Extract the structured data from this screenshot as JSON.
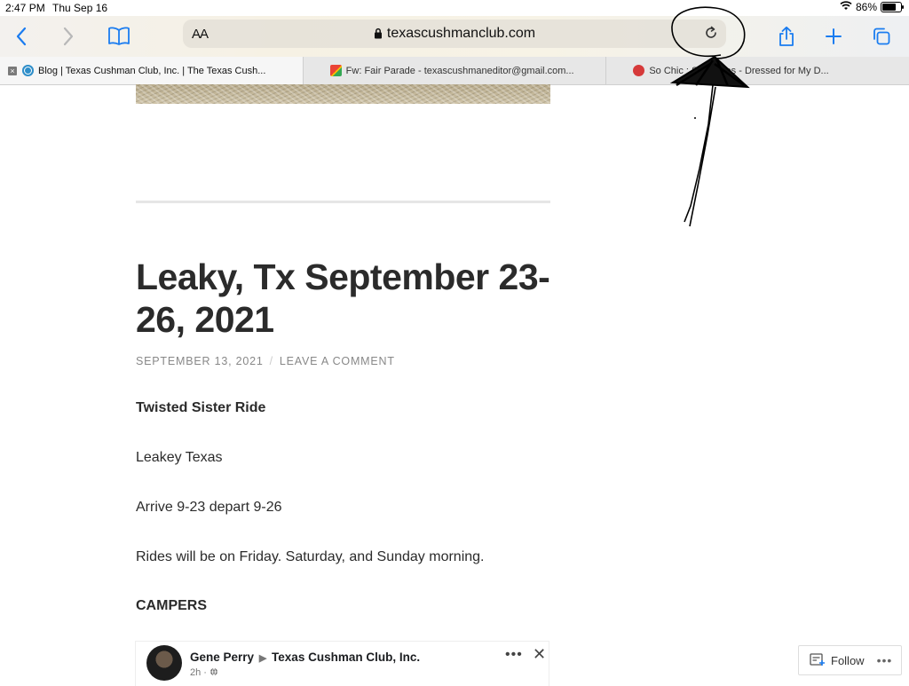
{
  "status": {
    "time": "2:47 PM",
    "date": "Thu Sep 16",
    "battery": "86%",
    "battery_level": 0.86
  },
  "toolbar": {
    "text_size_label": "AA",
    "url": "texascushmanclub.com"
  },
  "tabs": [
    {
      "title": "Blog | Texas Cushman Club, Inc. | The Texas Cush...",
      "active": true
    },
    {
      "title": "Fw: Fair Parade - texascushmaneditor@gmail.com..."
    },
    {
      "title": "So Chic : Separates - Dressed for My D..."
    }
  ],
  "post": {
    "title": "Leaky, Tx September 23-26, 2021",
    "date": "SEPTEMBER 13, 2021",
    "comment_link": "LEAVE A COMMENT",
    "paragraphs": {
      "p1": "Twisted Sister Ride",
      "p2": "Leakey Texas",
      "p3": "Arrive 9-23 depart 9-26",
      "p4": "Rides will be on Friday. Saturday, and Sunday morning.",
      "p5": "CAMPERS"
    }
  },
  "embed": {
    "author": "Gene Perry",
    "group": "Texas Cushman Club, Inc.",
    "time": "2h ·"
  },
  "follow": {
    "label": "Follow",
    "more": "•••"
  },
  "colors": {
    "accent": "#1a7cf0",
    "title": "#2b2b2b",
    "meta": "#888888"
  }
}
